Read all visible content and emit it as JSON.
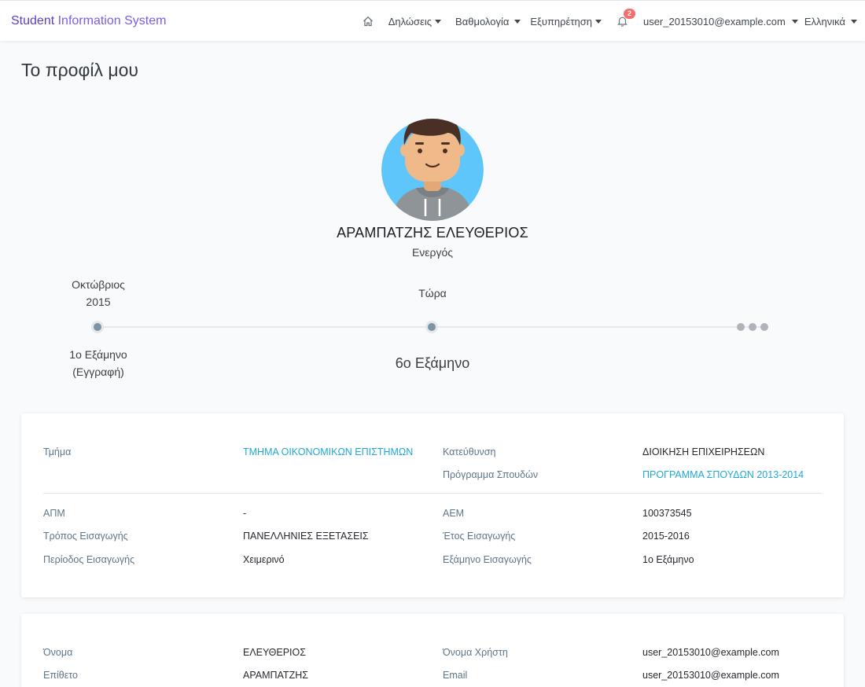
{
  "navbar": {
    "brand_part1": "Student",
    "brand_part2": " Information System",
    "home_icon": "home-icon",
    "menus": [
      "Δηλώσεις",
      "Βαθμολογία",
      "Εξυπηρέτηση"
    ],
    "notifications_count": "2",
    "user": "user_20153010@example.com",
    "language": "Ελληνικά"
  },
  "page": {
    "title": "Το προφίλ μου"
  },
  "profile": {
    "name": "ΑΡΑΜΠΑΤΖΗΣ ΕΛΕΥΘΕΡΙΟΣ",
    "status": "Ενεργός",
    "avatar_colors": {
      "background": "#5ec6fb",
      "skin": "#efb98a",
      "hair": "#4a2f25",
      "hoodie": "#8f9499"
    }
  },
  "timeline": {
    "start_date_line1": "Οκτώβριος",
    "start_date_line2": "2015",
    "start_semester_line1": "1ο Εξάμηνο",
    "start_semester_line2": "(Εγγραφή)",
    "now_label": "Τώρα",
    "current_semester": "6ο Εξάμηνο"
  },
  "study_info": {
    "department_label": "Τμήμα",
    "department_value": "ΤΜΗΜΑ ΟΙΚΟΝΟΜΙΚΩΝ ΕΠΙΣΤΗΜΩΝ",
    "direction_label": "Κατεύθυνση",
    "direction_value": "ΔΙΟΙΚΗΣΗ ΕΠΙΧΕΙΡΗΣΕΩΝ",
    "program_label": "Πρόγραμμα Σπουδών",
    "program_value": "ΠΡΟΓΡΑΜΜΑ ΣΠΟΥΔΩΝ 2013-2014",
    "apm_label": "ΑΠΜ",
    "apm_value": "-",
    "aem_label": "ΑΕΜ",
    "aem_value": "100373545",
    "entry_method_label": "Τρόπος Εισαγωγής",
    "entry_method_value": "ΠΑΝΕΛΛΗΝΙΕΣ ΕΞΕΤΑΣΕΙΣ",
    "entry_year_label": "Έτος Εισαγωγής",
    "entry_year_value": "2015-2016",
    "entry_period_label": "Περίοδος Εισαγωγής",
    "entry_period_value": "Χειμερινό",
    "entry_semester_label": "Εξάμηνο Εισαγωγής",
    "entry_semester_value": "1ο Εξάμηνο"
  },
  "personal_info": {
    "first_name_label": "Όνομα",
    "first_name_value": "ΕΛΕΥΘΕΡΙΟΣ",
    "username_label": "Όνομα Χρήστη",
    "username_value": "user_20153010@example.com",
    "last_name_label": "Επίθετο",
    "last_name_value": "ΑΡΑΜΠΑΤΖΗΣ",
    "email_label": "Email",
    "email_value": "user_20153010@example.com"
  },
  "colors": {
    "link": "#20a8d8",
    "label": "#5f7589",
    "badge": "#f86c6b"
  }
}
